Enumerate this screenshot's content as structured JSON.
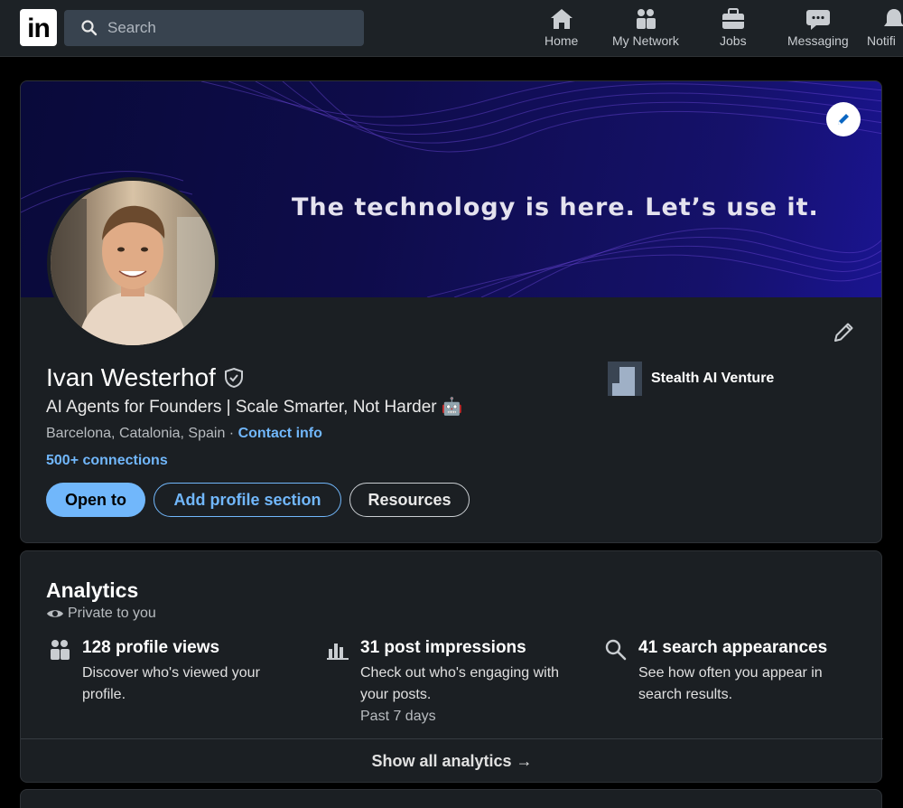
{
  "nav": {
    "logo": "in",
    "search_placeholder": "Search",
    "items": [
      {
        "label": "Home",
        "icon": "home-icon"
      },
      {
        "label": "My Network",
        "icon": "network-icon"
      },
      {
        "label": "Jobs",
        "icon": "briefcase-icon"
      },
      {
        "label": "Messaging",
        "icon": "messaging-icon"
      },
      {
        "label": "Notifi",
        "icon": "bell-icon"
      }
    ]
  },
  "profile": {
    "banner_text": "The technology is here. Let’s use it.",
    "name": "Ivan Westerhof",
    "headline": "AI Agents for Founders | Scale Smarter, Not Harder 🤖",
    "location": "Barcelona, Catalonia, Spain",
    "separator": " · ",
    "contact_info": "Contact info",
    "connections": "500+ connections",
    "buttons": {
      "open_to": "Open to",
      "add_section": "Add profile section",
      "resources": "Resources"
    },
    "company": "Stealth AI Venture"
  },
  "analytics": {
    "title": "Analytics",
    "privacy": "Private to you",
    "stats": [
      {
        "title": "128 profile views",
        "desc": "Discover who's viewed your profile.",
        "note": ""
      },
      {
        "title": "31 post impressions",
        "desc": "Check out who's engaging with your posts.",
        "note": "Past 7 days"
      },
      {
        "title": "41 search appearances",
        "desc": "See how often you appear in search results.",
        "note": ""
      }
    ],
    "show_all": "Show all analytics →"
  },
  "colors": {
    "accent": "#71b7fb",
    "card_bg": "#1b1f23",
    "page_bg": "#000000",
    "nav_bg": "#1d2226"
  }
}
